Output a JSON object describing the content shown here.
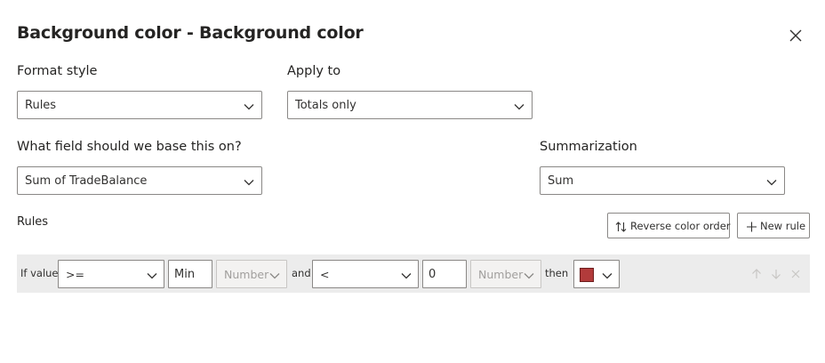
{
  "dialog": {
    "title": "Background color - Background color",
    "close_icon": "close-icon"
  },
  "format_style": {
    "label": "Format style",
    "value": "Rules"
  },
  "apply_to": {
    "label": "Apply to",
    "value": "Totals only"
  },
  "base_field": {
    "label": "What field should we base this on?",
    "value": "Sum of TradeBalance"
  },
  "summarization": {
    "label": "Summarization",
    "value": "Sum"
  },
  "rules": {
    "label": "Rules",
    "reverse_button": "Reverse color order",
    "new_rule_button": "New rule",
    "items": [
      {
        "if_value": "If value",
        "op1": ">=",
        "val1": "Min",
        "type1": "Number",
        "and": "and",
        "op2": "<",
        "val2": "0",
        "type2": "Number",
        "then": "then",
        "color": "#b23b3b"
      }
    ]
  },
  "colors": {
    "border": "#8a8886",
    "row_bg": "#ececec",
    "text": "#252423"
  }
}
